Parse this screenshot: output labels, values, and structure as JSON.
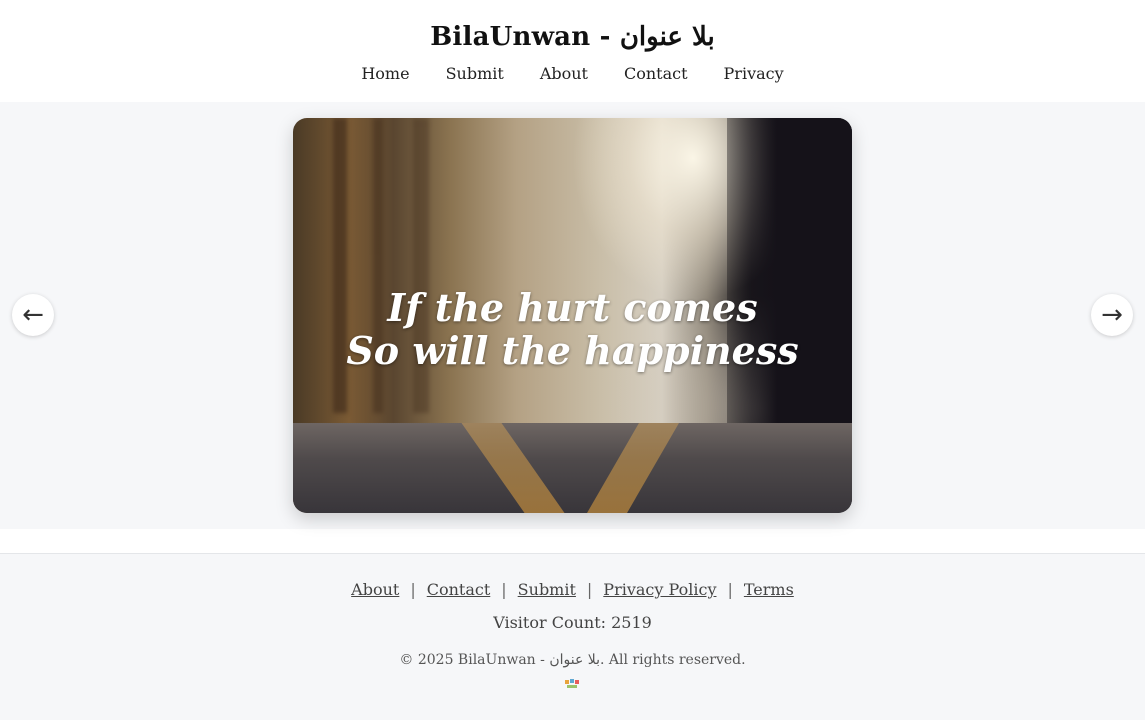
{
  "header": {
    "title": "BilaUnwan - بلا عنوان",
    "nav": [
      "Home",
      "Submit",
      "About",
      "Contact",
      "Privacy"
    ]
  },
  "slider": {
    "quote_line1": "If the hurt comes",
    "quote_line2": "So will the happiness",
    "prev_icon": "←",
    "next_icon": "→"
  },
  "footer": {
    "links": [
      "About",
      "Contact",
      "Submit",
      "Privacy Policy",
      "Terms"
    ],
    "separator": "|",
    "visitor_count": "Visitor Count: 2519",
    "copyright": "© 2025 BilaUnwan - بلا عنوان. All rights reserved."
  },
  "colors": {
    "background": "#ffffff",
    "stage_background": "#f6f7f9",
    "footer_background": "#f6f7f9"
  }
}
